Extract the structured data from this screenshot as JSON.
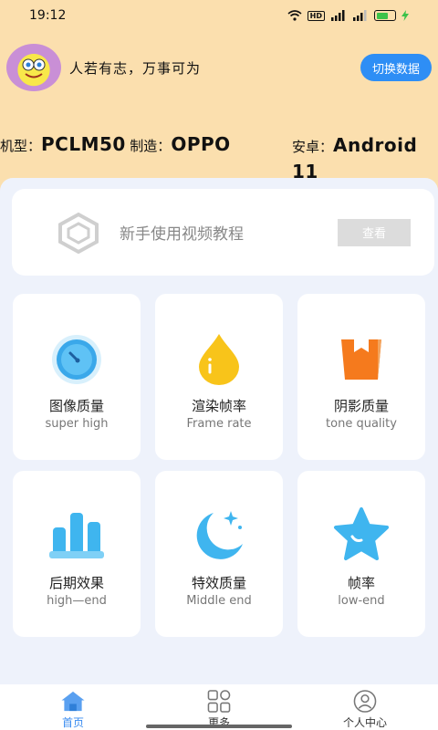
{
  "status_bar": {
    "time": "19:12",
    "hd_label": "HD"
  },
  "profile": {
    "motto": "人若有志，万事可为",
    "switch_label": "切换数据"
  },
  "device": {
    "model_key": "机型：",
    "model_value": "PCLM50",
    "maker_key": "制造：",
    "maker_value": "OPPO",
    "android_key": "安卓：",
    "android_value": "Android 11"
  },
  "tutorial": {
    "text": "新手使用视频教程",
    "button_label": "查看"
  },
  "tiles": [
    {
      "cn": "图像质量",
      "en": "super high",
      "icon": "stopwatch-icon"
    },
    {
      "cn": "渲染帧率",
      "en": "Frame rate",
      "icon": "drop-icon"
    },
    {
      "cn": "阴影质量",
      "en": "tone quality",
      "icon": "box-icon"
    },
    {
      "cn": "后期效果",
      "en": "high—end",
      "icon": "bar-chart-icon"
    },
    {
      "cn": "特效质量",
      "en": "Middle end",
      "icon": "moon-icon"
    },
    {
      "cn": "帧率",
      "en": "low-end",
      "icon": "star-icon"
    }
  ],
  "tabbar": [
    {
      "label": "首页",
      "active": true
    },
    {
      "label": "更多",
      "active": false
    },
    {
      "label": "个人中心",
      "active": false
    }
  ],
  "colors": {
    "accent": "#2e8ef5",
    "header_bg": "#fbdfae",
    "panel_bg": "#eef2fb"
  }
}
